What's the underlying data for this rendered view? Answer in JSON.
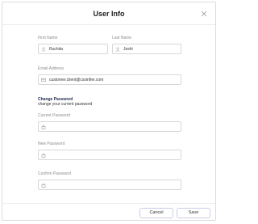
{
  "dialog": {
    "title": "User Info"
  },
  "form": {
    "first_name": {
      "label": "First Name",
      "value": "Ruchita"
    },
    "last_name": {
      "label": "Last Name",
      "value": "Joshi"
    },
    "email": {
      "label": "Email Address",
      "value": "customer.client@cssinfier.com"
    },
    "change_password": {
      "title": "Change Password",
      "subtitle": "change your current password",
      "current_label": "Current Password",
      "new_label": "New Password",
      "confirm_label": "Confirm Password"
    }
  },
  "footer": {
    "cancel_label": "Cancel",
    "save_label": "Save"
  },
  "colors": {
    "accent": "#1e2a4d",
    "border": "#d7d7d7",
    "label": "#8d8d8d"
  }
}
